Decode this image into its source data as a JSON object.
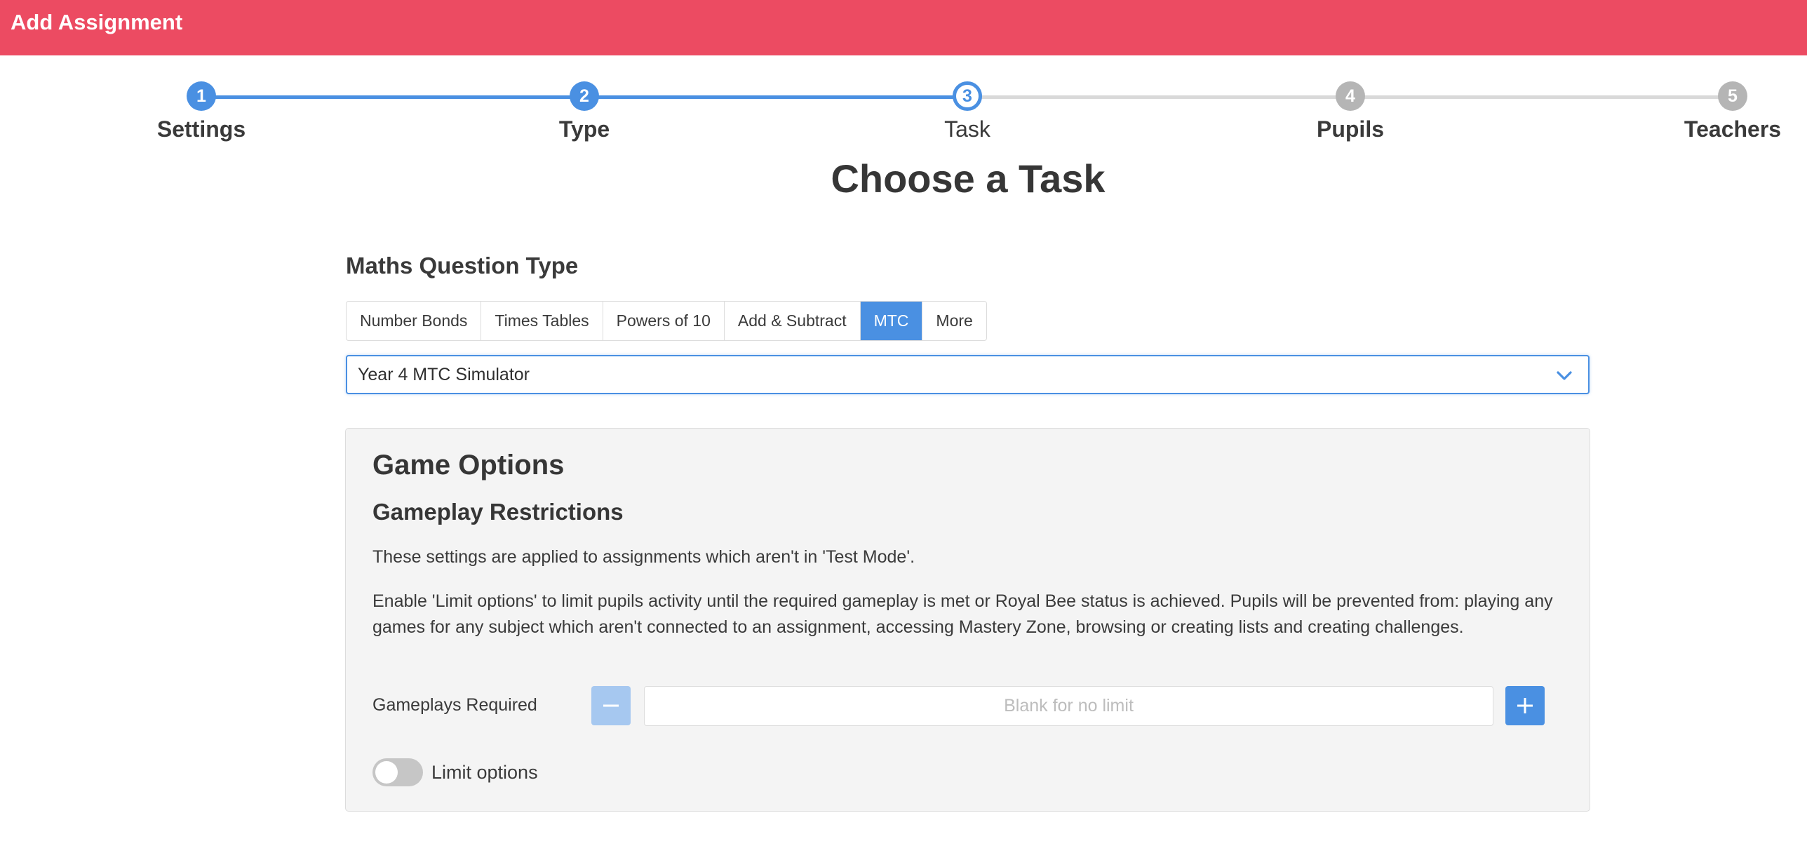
{
  "header": {
    "title": "Add Assignment",
    "color": "#ec4b62"
  },
  "stepper": {
    "steps": [
      {
        "number": "1",
        "label": "Settings",
        "state": "done"
      },
      {
        "number": "2",
        "label": "Type",
        "state": "done"
      },
      {
        "number": "3",
        "label": "Task",
        "state": "current"
      },
      {
        "number": "4",
        "label": "Pupils",
        "state": "upcoming"
      },
      {
        "number": "5",
        "label": "Teachers",
        "state": "upcoming"
      }
    ],
    "accent": "#4a90e2"
  },
  "main": {
    "title": "Choose a Task",
    "question_type_label": "Maths Question Type",
    "tabs": [
      {
        "label": "Number Bonds",
        "active": false
      },
      {
        "label": "Times Tables",
        "active": false
      },
      {
        "label": "Powers of 10",
        "active": false
      },
      {
        "label": "Add & Subtract",
        "active": false
      },
      {
        "label": "MTC",
        "active": true
      },
      {
        "label": "More",
        "active": false
      }
    ],
    "task_select": {
      "value": "Year 4 MTC Simulator",
      "icon": "chevron-down-icon"
    }
  },
  "game_options": {
    "title": "Game Options",
    "subtitle": "Gameplay Restrictions",
    "paragraph1": "These settings are applied to assignments which aren't in 'Test Mode'.",
    "paragraph2": "Enable 'Limit options' to limit pupils activity until the required gameplay is met or Royal Bee status is achieved. Pupils will be prevented from: playing any games for any subject which aren't connected to an assignment, accessing Mastery Zone, browsing or creating lists and creating challenges.",
    "gameplays_label": "Gameplays Required",
    "gameplays_input": {
      "value": "",
      "placeholder": "Blank for no limit"
    },
    "minus_icon": "minus-icon",
    "plus_icon": "plus-icon",
    "limit_toggle": {
      "label": "Limit options",
      "checked": false
    }
  }
}
